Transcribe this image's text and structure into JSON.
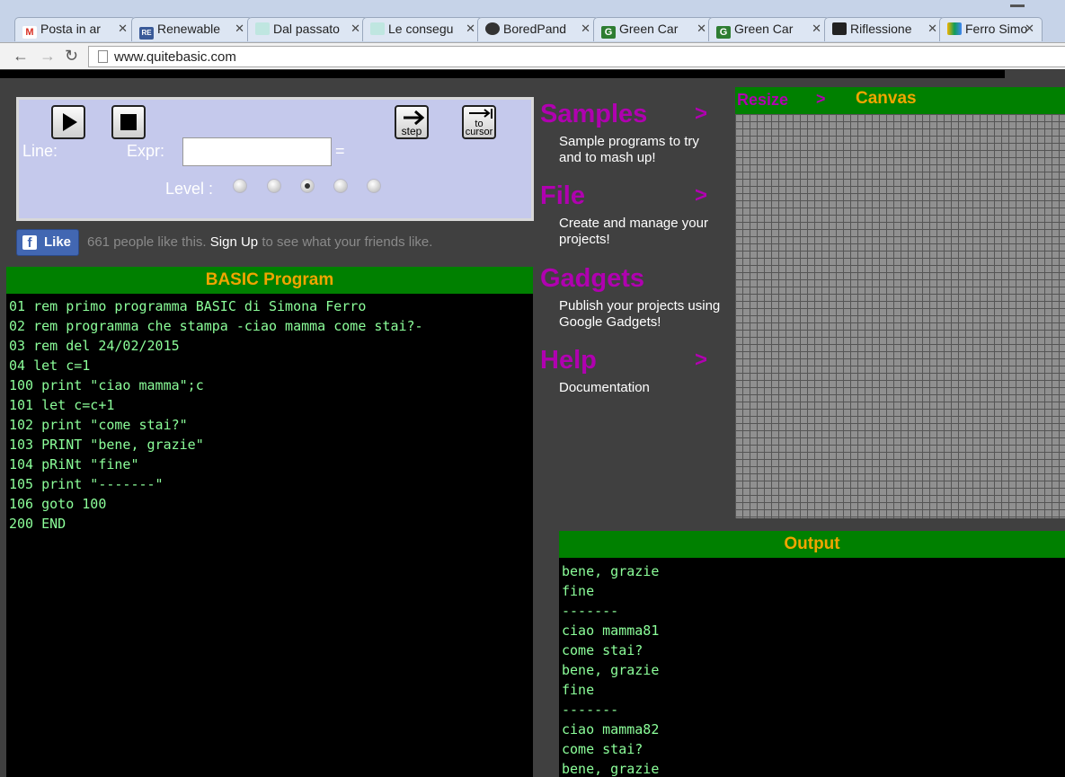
{
  "browser": {
    "tabs": [
      {
        "title": "Posta in ar",
        "favicon": "M"
      },
      {
        "title": "Renewable",
        "favicon": "RE"
      },
      {
        "title": "Dal passato",
        "favicon": ""
      },
      {
        "title": "Le consegu",
        "favicon": ""
      },
      {
        "title": "BoredPand",
        "favicon": ""
      },
      {
        "title": "Green Car",
        "favicon": "G"
      },
      {
        "title": "Green Car",
        "favicon": "G"
      },
      {
        "title": "Riflessione",
        "favicon": ""
      },
      {
        "title": "Ferro Simo",
        "favicon": ""
      }
    ],
    "url": "www.quitebasic.com"
  },
  "debugger": {
    "line_label": "Line:",
    "expr_label": "Expr:",
    "equals": "=",
    "level_label": "Level :",
    "step_label": "step",
    "cursor_label_1": "to",
    "cursor_label_2": "cursor",
    "expr_value": "",
    "level_selected": 3
  },
  "facebook": {
    "like_label": "Like",
    "count_text": "661 people like this.",
    "signup": "Sign Up",
    "suffix": "to see what your friends like."
  },
  "program": {
    "header": "BASIC Program",
    "lines": [
      "01 rem primo programma BASIC di Simona Ferro",
      "02 rem programma che stampa -ciao mamma come stai?-",
      "03 rem del 24/02/2015",
      "04 let c=1",
      "100 print \"ciao mamma\";c",
      "101 let c=c+1",
      "102 print \"come stai?\"",
      "103 PRINT \"bene, grazie\"",
      "104 pRiNt \"fine\"",
      "105 print \"-------\"",
      "106 goto 100",
      "200 END"
    ]
  },
  "menu": {
    "arrow": ">",
    "samples_title": "Samples",
    "samples_desc": "Sample programs to try and to mash up!",
    "file_title": "File",
    "file_desc": "Create and manage your projects!",
    "gadgets_title": "Gadgets",
    "gadgets_desc": "Publish your projects using Google Gadgets!",
    "help_title": "Help",
    "help_desc": "Documentation"
  },
  "canvas": {
    "resize_label": "Resize",
    "resize_arrow": ">",
    "title": "Canvas"
  },
  "output": {
    "header": "Output",
    "lines": [
      "bene, grazie",
      "fine",
      "-------",
      "ciao mamma81",
      "come stai?",
      "bene, grazie",
      "fine",
      "-------",
      "ciao mamma82",
      "come stai?",
      "bene, grazie"
    ]
  },
  "colors": {
    "header_green": "#008000",
    "header_text": "#f0a500",
    "menu_purple": "#b000b0",
    "code_green": "#8cff9a"
  }
}
